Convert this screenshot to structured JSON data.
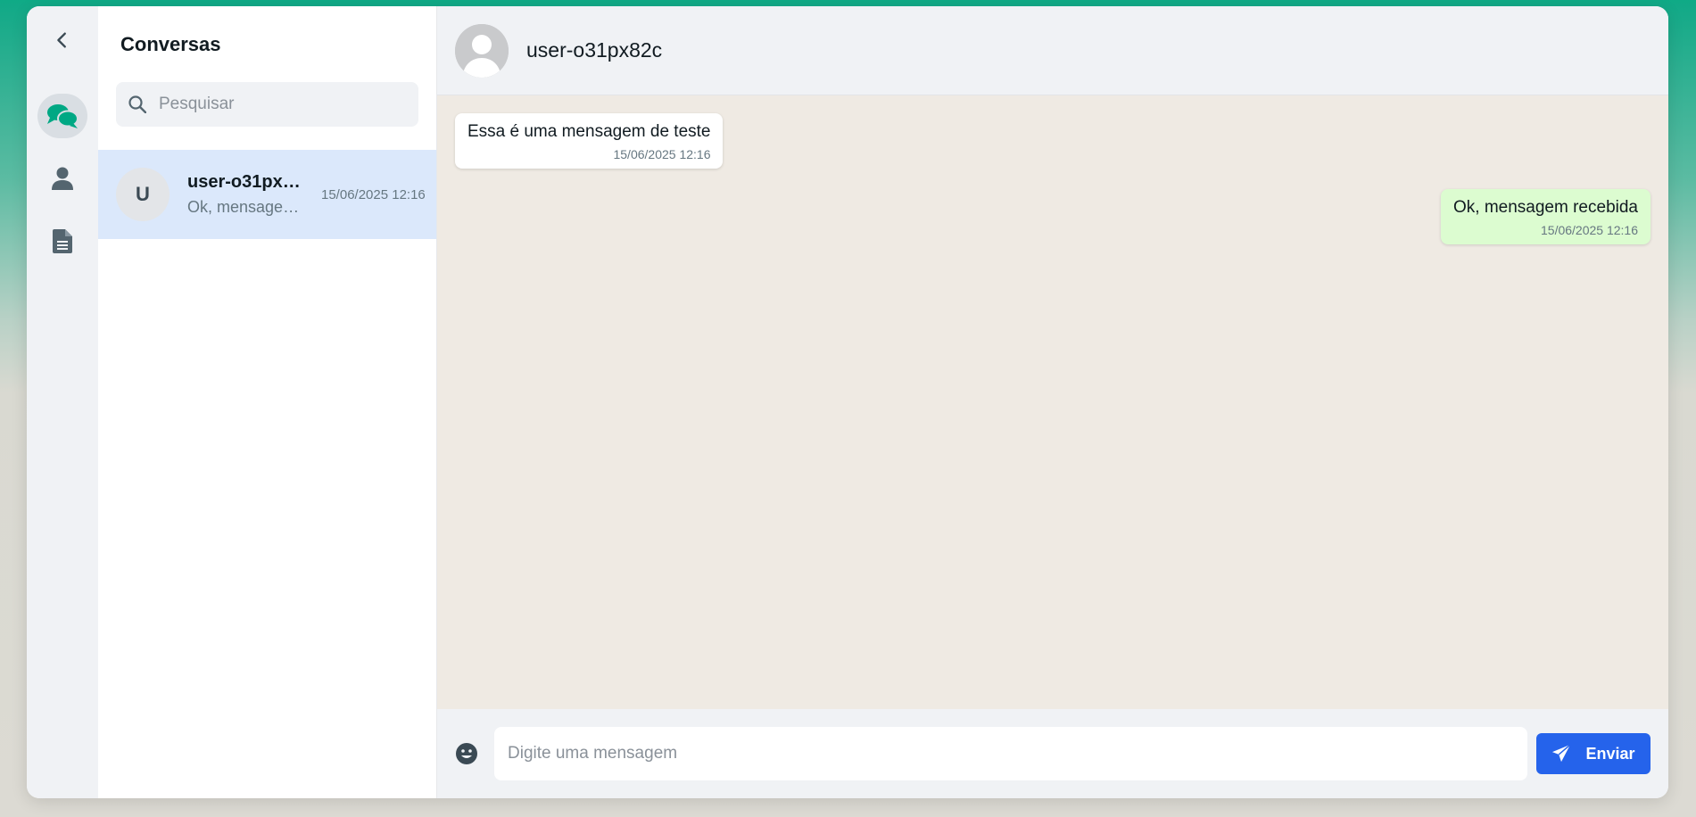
{
  "sidebar": {
    "list_title": "Conversas",
    "search_placeholder": "Pesquisar",
    "conversations": [
      {
        "avatar_letter": "U",
        "name": "user-o31px82c",
        "preview": "Ok, mensagem recebida",
        "time": "15/06/2025 12:16"
      }
    ]
  },
  "chat": {
    "contact_name": "user-o31px82c",
    "messages": [
      {
        "direction": "incoming",
        "text": "Essa é uma mensagem de teste",
        "time": "15/06/2025 12:16"
      },
      {
        "direction": "outgoing",
        "text": "Ok, mensagem recebida",
        "time": "15/06/2025 12:16"
      }
    ],
    "composer": {
      "placeholder": "Digite uma mensagem",
      "send_label": "Enviar"
    }
  },
  "icons": {
    "back": "chevron-left-icon",
    "chats": "chat-bubbles-icon",
    "contacts": "user-icon",
    "documents": "document-icon",
    "search": "search-icon",
    "emoji": "smiley-icon",
    "send": "paper-plane-icon"
  },
  "colors": {
    "accent": "#00a884",
    "send_button": "#2563eb",
    "selected_conversation": "#dbe8fb",
    "outgoing_bubble": "#dcfcd0",
    "chat_background": "#efeae3"
  }
}
